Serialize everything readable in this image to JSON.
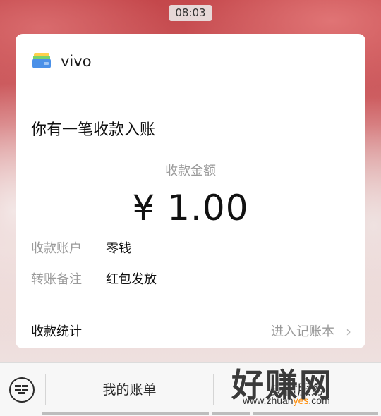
{
  "status_bar": {
    "time": "08:03"
  },
  "notification": {
    "app_name": "vivo",
    "title": "你有一笔收款入账",
    "amount_label": "收款金额",
    "amount": "¥ 1.00",
    "rows": [
      {
        "label": "收款账户",
        "value": "零钱"
      },
      {
        "label": "转账备注",
        "value": "红包发放"
      }
    ],
    "stats": {
      "label": "收款统计",
      "link": "进入记账本"
    }
  },
  "bottom_menu": {
    "items": [
      {
        "label": "我的账单"
      },
      {
        "label": "支付服务"
      }
    ]
  },
  "watermark": {
    "brand": "好赚网",
    "url_pre": "www.zhuan",
    "url_hl": "yes",
    "url_post": ".com"
  },
  "colors": {
    "accent_watermark": "#ff8a00",
    "card": "#ffffff"
  }
}
